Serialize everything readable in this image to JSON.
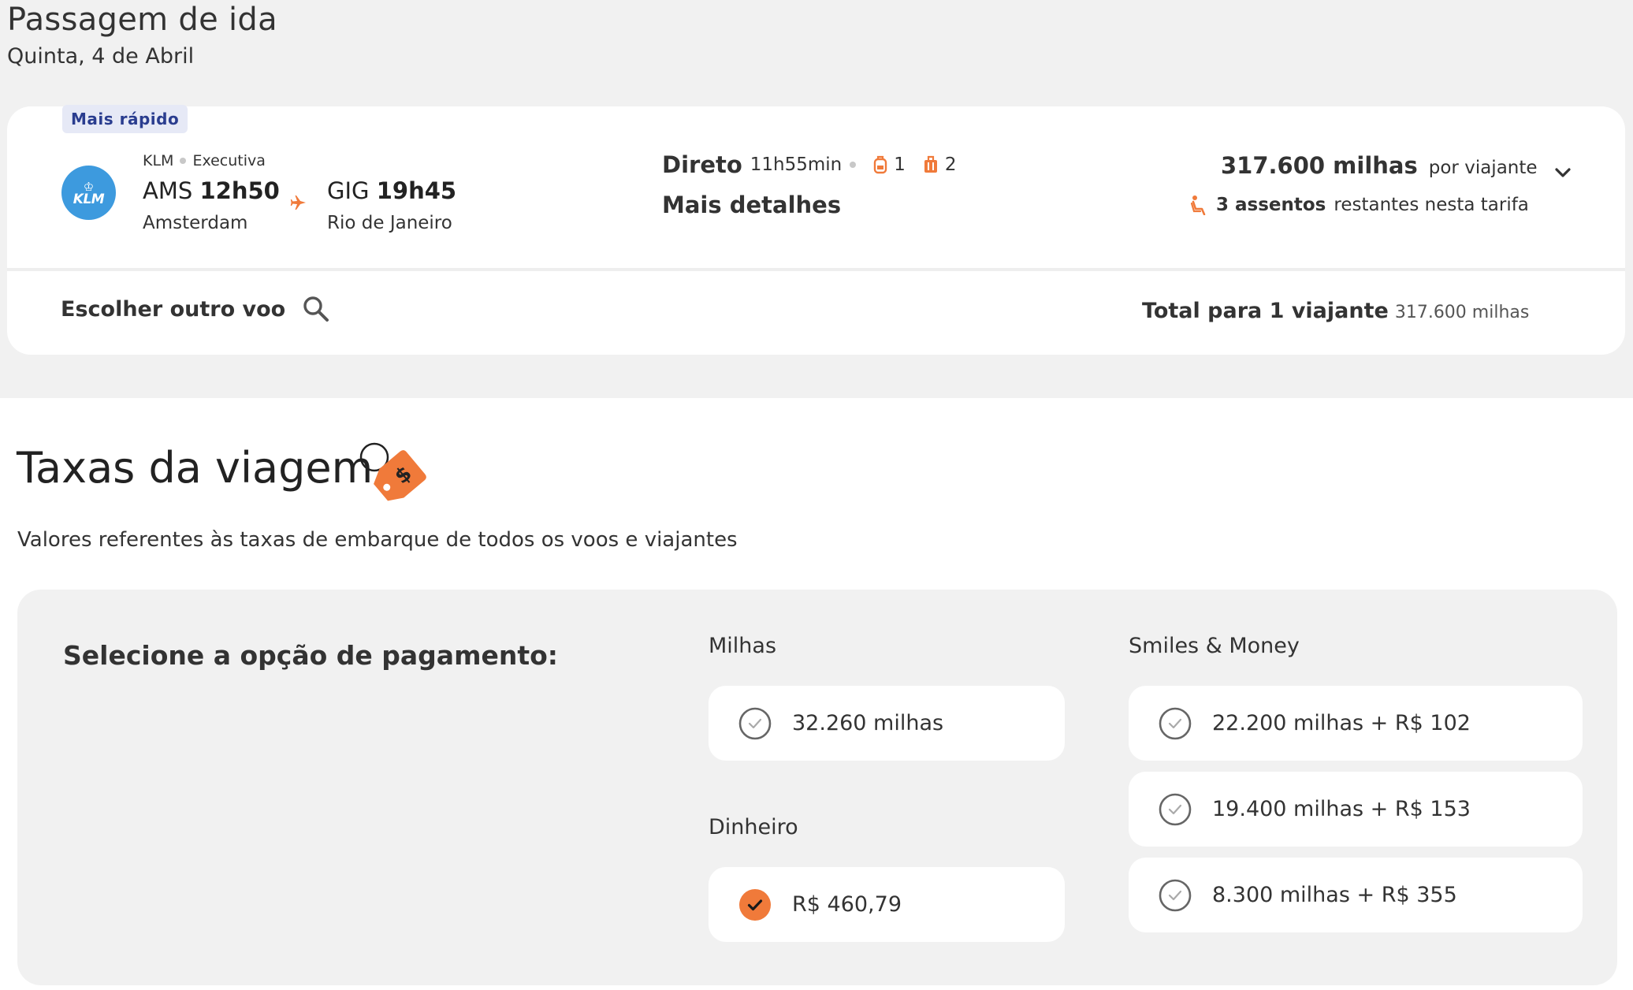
{
  "header": {
    "title": "Passagem de ida",
    "date": "Quinta, 4 de Abril"
  },
  "flight": {
    "badge": "Mais rápido",
    "airline_name": "KLM",
    "logo_text": "KLM",
    "cabin": "Executiva",
    "departure": {
      "code": "AMS",
      "time": "12h50",
      "city": "Amsterdam"
    },
    "arrival": {
      "code": "GIG",
      "time": "19h45",
      "city": "Rio de Janeiro"
    },
    "stops_label": "Direto",
    "duration": "11h55min",
    "backpack_count": "1",
    "suitcase_count": "2",
    "details_link": "Mais detalhes",
    "price": "317.600 milhas",
    "price_unit": "por viajante",
    "seats_bold": "3 assentos",
    "seats_rest": "restantes nesta tarifa",
    "other_flight_label": "Escolher outro voo",
    "total_label": "Total para 1 viajante",
    "total_value": "317.600 milhas"
  },
  "fees": {
    "title": "Taxas da viagem",
    "subtitle": "Valores referentes às taxas de embarque de todos os voos e viajantes",
    "payment_heading": "Selecione a opção de pagamento:",
    "groups": {
      "miles_label": "Milhas",
      "money_label": "Dinheiro",
      "smiles_money_label": "Smiles & Money"
    },
    "options": {
      "miles": {
        "label": "32.260 milhas",
        "selected": false
      },
      "money": {
        "label": "R$ 460,79",
        "selected": true
      },
      "mixed": [
        {
          "label": "22.200 milhas + R$ 102",
          "selected": false
        },
        {
          "label": "19.400 milhas + R$ 153",
          "selected": false
        },
        {
          "label": "8.300 milhas + R$ 355",
          "selected": false
        }
      ]
    }
  },
  "colors": {
    "accent": "#f07a3a",
    "badge_bg": "#e6e9f6",
    "badge_text": "#2a3d8f",
    "klm_blue": "#3d9ade",
    "panel_bg": "#f1f1f1"
  },
  "icons": [
    "plane-icon",
    "backpack-icon",
    "suitcase-icon",
    "seat-icon",
    "chevron-down-icon",
    "search-icon",
    "price-tag-icon",
    "check-circle-icon"
  ]
}
